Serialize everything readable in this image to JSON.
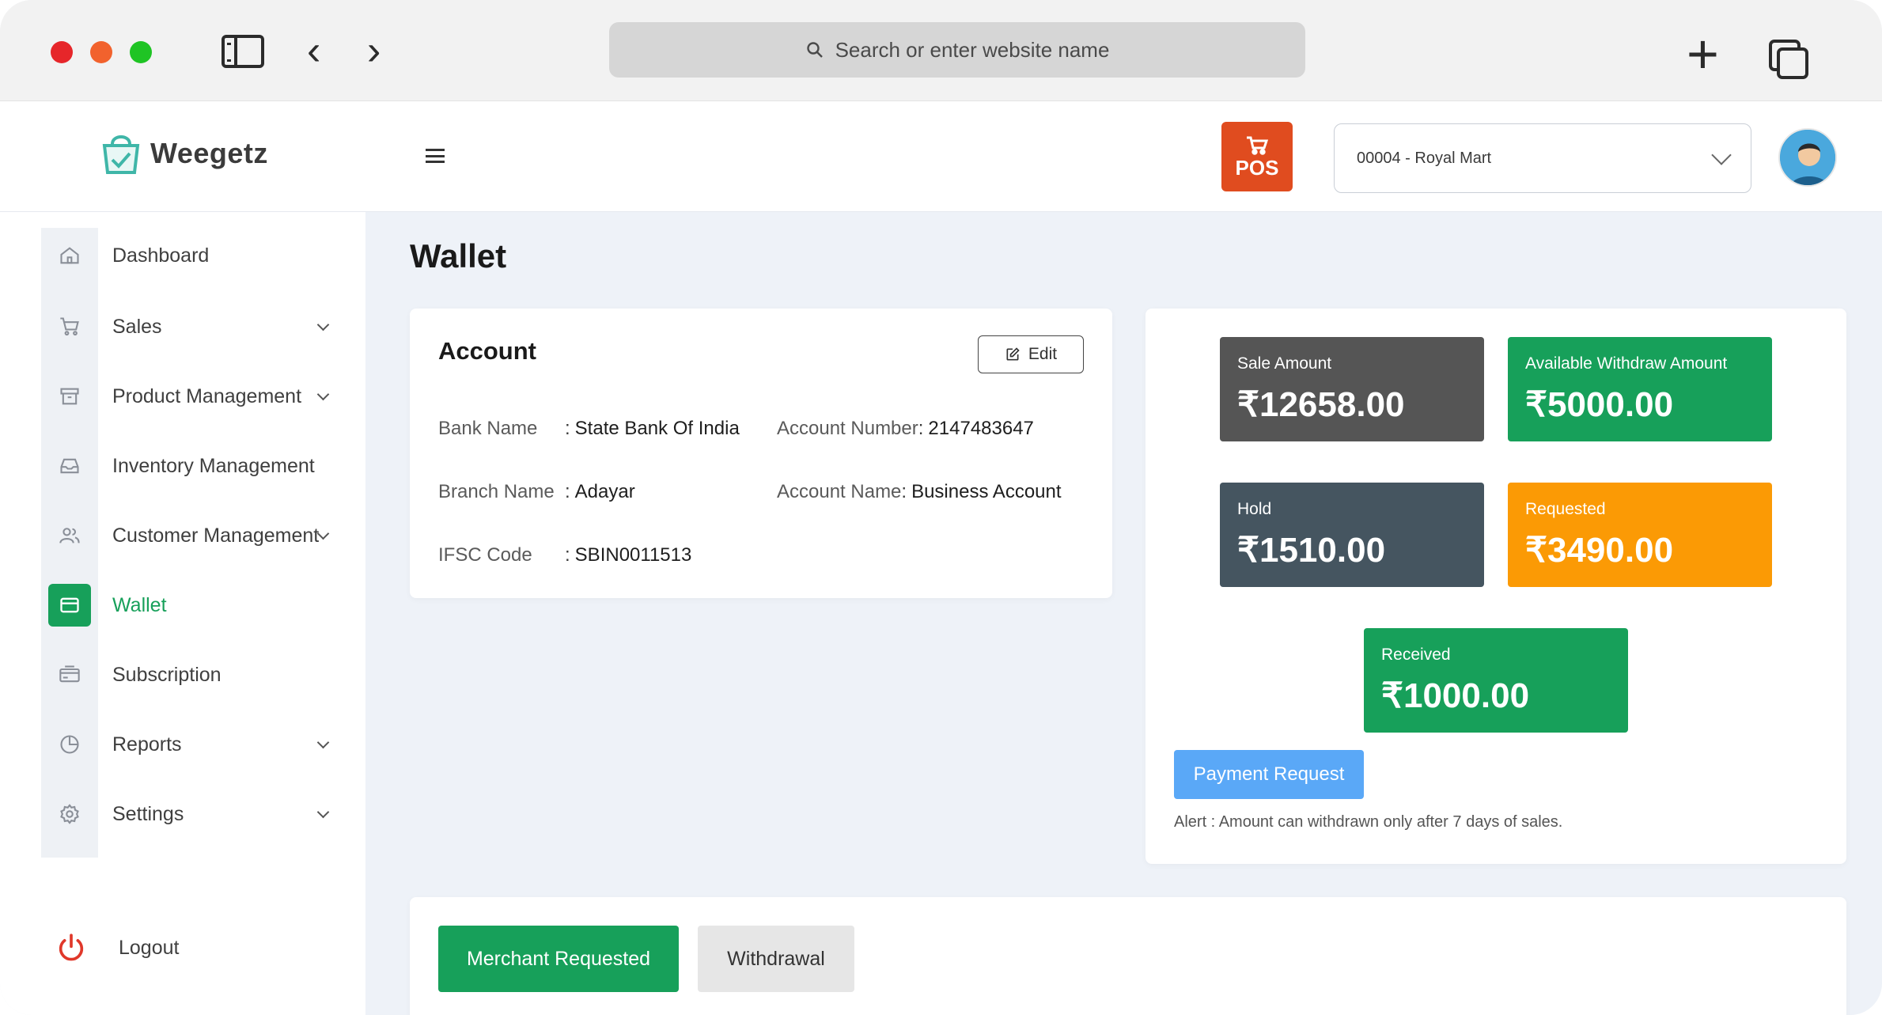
{
  "browser": {
    "address_placeholder": "Search or enter website name"
  },
  "header": {
    "logo_text": "Weegetz",
    "pos_label": "POS",
    "store_selected": "00004 - Royal Mart"
  },
  "sidebar": {
    "items": [
      {
        "label": "Dashboard",
        "icon": "home-icon",
        "has_submenu": false
      },
      {
        "label": "Sales",
        "icon": "cart-icon",
        "has_submenu": true
      },
      {
        "label": "Product Management",
        "icon": "archive-icon",
        "has_submenu": true
      },
      {
        "label": "Inventory Management",
        "icon": "inbox-icon",
        "has_submenu": false
      },
      {
        "label": "Customer Management",
        "icon": "users-icon",
        "has_submenu": true
      },
      {
        "label": "Wallet",
        "icon": "wallet-icon",
        "has_submenu": false,
        "active": true
      },
      {
        "label": "Subscription",
        "icon": "subscription-icon",
        "has_submenu": false
      },
      {
        "label": "Reports",
        "icon": "pie-chart-icon",
        "has_submenu": true
      },
      {
        "label": "Settings",
        "icon": "gear-icon",
        "has_submenu": true
      }
    ],
    "logout_label": "Logout"
  },
  "main": {
    "page_title": "Wallet",
    "account": {
      "title": "Account",
      "edit_label": "Edit",
      "bank_name_label": "Bank Name",
      "bank_name_value": "State Bank Of India",
      "account_number_label": "Account Number",
      "account_number_value": "2147483647",
      "branch_name_label": "Branch Name",
      "branch_name_value": "Adayar",
      "account_name_label": "Account Name",
      "account_name_value": "Business Account",
      "ifsc_label": "IFSC Code",
      "ifsc_value": "SBIN0011513"
    },
    "stats": {
      "sale_amount": {
        "label": "Sale Amount",
        "value": "₹12658.00",
        "color": "#555555"
      },
      "available_withdraw": {
        "label": "Available Withdraw Amount",
        "value": "₹5000.00",
        "color": "#17a05a"
      },
      "hold": {
        "label": "Hold",
        "value": "₹1510.00",
        "color": "#455560"
      },
      "requested": {
        "label": "Requested",
        "value": "₹3490.00",
        "color": "#fb9a05"
      },
      "received": {
        "label": "Received",
        "value": "₹1000.00",
        "color": "#17a05a"
      }
    },
    "payment_request_label": "Payment Request",
    "alert_text": "Alert : Amount can withdrawn only after 7 days of sales.",
    "tabs": [
      {
        "label": "Merchant Requested",
        "active": true
      },
      {
        "label": "Withdrawal",
        "active": false
      }
    ]
  },
  "colors": {
    "accent": "#17a05a",
    "pos": "#e04c1f",
    "payment_button": "#5aa8f7"
  }
}
